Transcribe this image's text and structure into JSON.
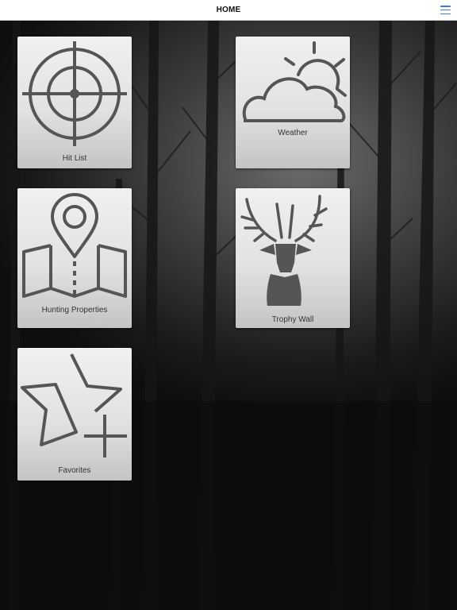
{
  "header": {
    "title": "HOME"
  },
  "tiles": {
    "hit_list": {
      "label": "Hit List",
      "icon": "crosshair-icon"
    },
    "weather": {
      "label": "Weather",
      "icon": "cloud-sun-icon"
    },
    "hunting_properties": {
      "label": "Hunting Properties",
      "icon": "map-pin-icon"
    },
    "trophy_wall": {
      "label": "Trophy Wall",
      "icon": "deer-head-icon"
    },
    "favorites": {
      "label": "Favorites",
      "icon": "star-plus-icon"
    }
  },
  "colors": {
    "header_bg": "#ffffff",
    "menu_accent": "#3b7bd9",
    "icon_color": "#555555",
    "tile_top": "#f0f0f0",
    "tile_bottom": "#c4c4c4"
  }
}
